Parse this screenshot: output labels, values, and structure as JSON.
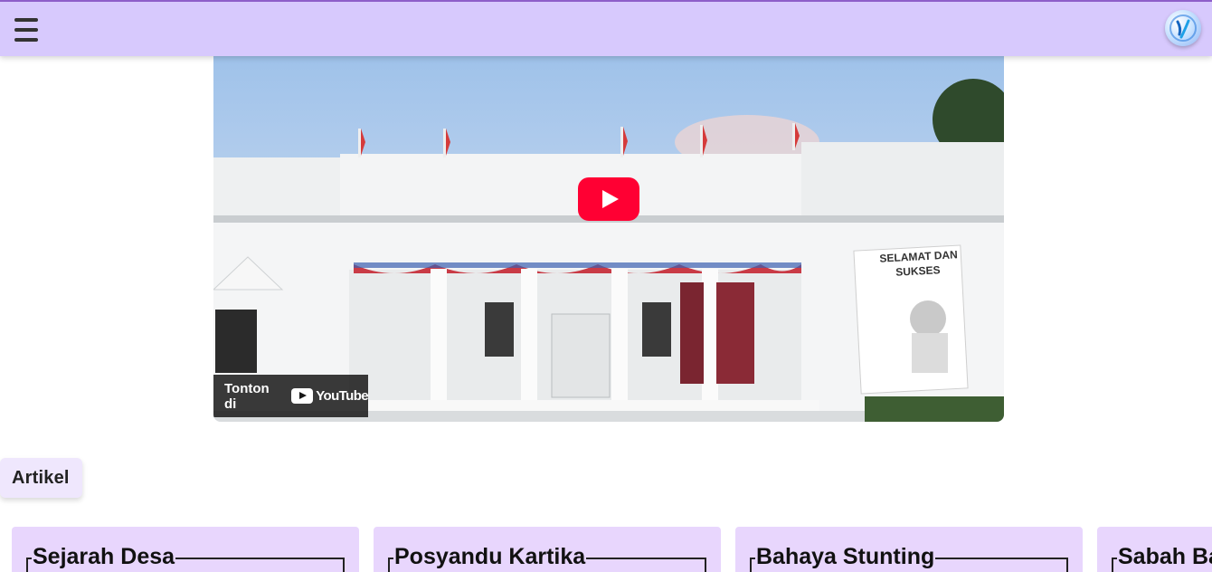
{
  "header": {
    "menu_icon": "hamburger-menu-icon",
    "logo_icon": "site-logo"
  },
  "video": {
    "play_icon": "youtube-play-icon",
    "watch_on_label": "Tonton di",
    "youtube_wordmark": "YouTube",
    "thumbnail_sign_lines": [
      "SELAMAT DAN",
      "SUKSES"
    ]
  },
  "section": {
    "title": "Artikel"
  },
  "articles": [
    {
      "title": "Sejarah Desa"
    },
    {
      "title": "Posyandu Kartika"
    },
    {
      "title": "Bahaya Stunting"
    },
    {
      "title": "Sabah Ba"
    }
  ],
  "colors": {
    "header_bg": "#d7c9fd",
    "header_border": "#8d5ec9",
    "card_bg": "#e8d6fd",
    "chip_bg": "#efe7fd",
    "play_red": "#ff0033"
  }
}
